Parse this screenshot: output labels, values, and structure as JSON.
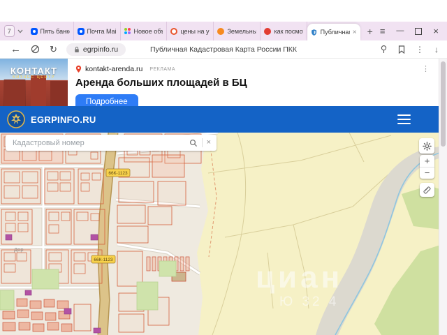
{
  "browser": {
    "tab_count": "7",
    "tabs": [
      {
        "label": "Пять банков в"
      },
      {
        "label": "Почта Mail"
      },
      {
        "label": "Новое объявл"
      },
      {
        "label": "цены на участ"
      },
      {
        "label": "Земельные уч"
      },
      {
        "label": "как посмотрет"
      },
      {
        "label": "Публичная"
      }
    ],
    "url": "egrpinfo.ru",
    "page_title": "Публичная Кадастровая Карта России ПКК"
  },
  "icons": {
    "back": "←",
    "reload": "↻",
    "more": "⋮",
    "download": "↓",
    "menu": "≡",
    "minimize": "—",
    "close": "×",
    "new_tab": "+",
    "tab_close": "×",
    "ad_more": "⋮",
    "zoom_in": "+",
    "zoom_out": "−",
    "clear_search": "×"
  },
  "ad": {
    "image_title": "КОНТАКТ",
    "image_subtitle": "БИЗНЕС ЦЕНТР",
    "domain": "kontakt-arenda.ru",
    "badge": "РЕКЛАМА",
    "headline": "Аренда больших площадей в БЦ",
    "button": "Подробнее"
  },
  "site": {
    "brand": "EGRPINFO.RU"
  },
  "map": {
    "search_placeholder": "Кадастровый номер",
    "road_label": "66К-1123",
    "street_label": "Дор",
    "watermark_line1": "циан",
    "watermark_line2": "Ю 32 4"
  },
  "colors": {
    "header_blue": "#1463c6",
    "ad_button_blue": "#2e7cf6",
    "tabbar_lilac": "#f1e2f2",
    "field_yellow": "#f6f1c6",
    "parcel_red": "#d45f3a"
  }
}
